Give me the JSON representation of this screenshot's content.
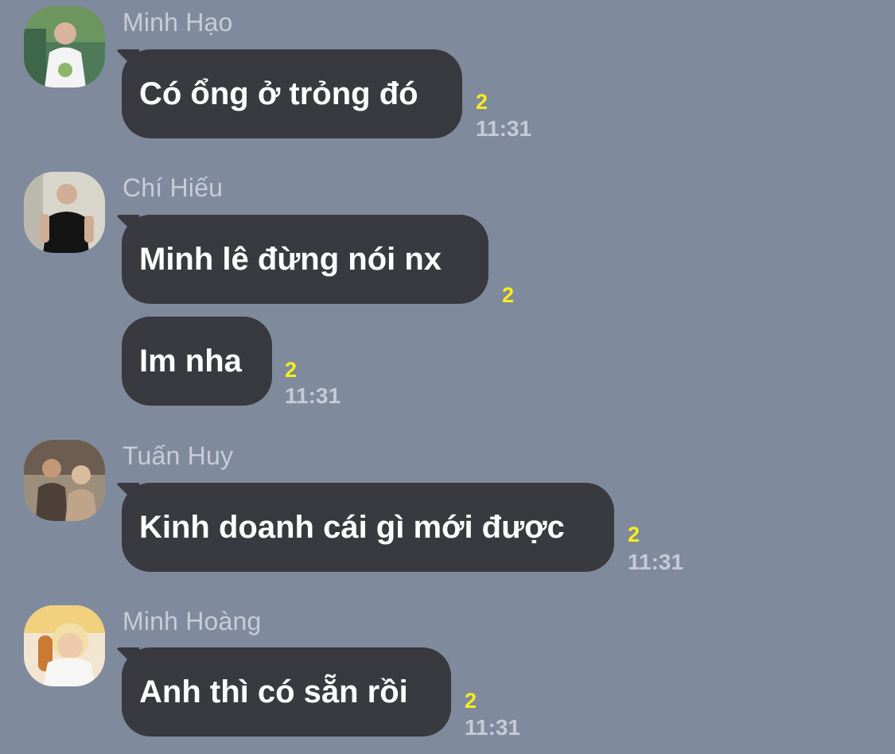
{
  "messages": [
    {
      "sender": "Minh Hạo",
      "avatar": "profile-photo",
      "bubbles": [
        {
          "text": "Có ổng ở trỏng đó",
          "unread": "2",
          "time": "11:31"
        }
      ]
    },
    {
      "sender": "Chí Hiếu",
      "avatar": "profile-photo",
      "bubbles": [
        {
          "text": "Minh lê đừng nói nx",
          "unread": "2",
          "time": ""
        },
        {
          "text": "Im nha",
          "unread": "2",
          "time": "11:31"
        }
      ]
    },
    {
      "sender": "Tuấn Huy",
      "avatar": "profile-photo",
      "bubbles": [
        {
          "text": "Kinh doanh cái gì mới được",
          "unread": "2",
          "time": "11:31"
        }
      ]
    },
    {
      "sender": "Minh Hoàng",
      "avatar": "profile-photo",
      "bubbles": [
        {
          "text": "Anh thì có sẵn rồi",
          "unread": "2",
          "time": "11:31"
        }
      ]
    }
  ],
  "colors": {
    "background": "#808a9d",
    "bubble": "#393a3f",
    "message_text": "#ffffff",
    "sender_name": "#c6ccd8",
    "unread_count": "#f7ed19",
    "timestamp": "#c4cad6"
  }
}
